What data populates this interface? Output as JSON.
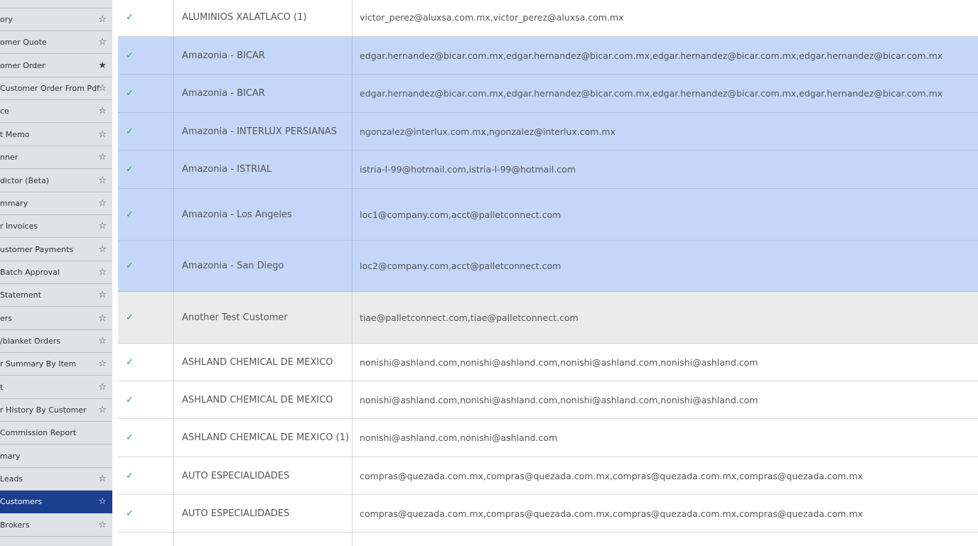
{
  "sidebar": {
    "items": [
      {
        "label": "",
        "starred": false,
        "active": false
      },
      {
        "label": "ory",
        "starred": false,
        "active": false
      },
      {
        "label": "omer Quote",
        "starred": false,
        "active": false
      },
      {
        "label": "omer Order",
        "starred": true,
        "active": false
      },
      {
        "label": "Customer Order From Pdf",
        "starred": false,
        "active": false
      },
      {
        "label": "ce",
        "starred": false,
        "active": false
      },
      {
        "label": "t Memo",
        "starred": false,
        "active": false
      },
      {
        "label": "nner",
        "starred": false,
        "active": false
      },
      {
        "label": "dictor (Beta)",
        "starred": false,
        "active": false
      },
      {
        "label": "mmary",
        "starred": false,
        "active": false
      },
      {
        "label": "r Invoices",
        "starred": false,
        "active": false
      },
      {
        "label": "ustomer Payments",
        "starred": false,
        "active": false
      },
      {
        "label": "Batch Approval",
        "starred": false,
        "active": false
      },
      {
        "label": "Statement",
        "starred": false,
        "active": false
      },
      {
        "label": "ers",
        "starred": false,
        "active": false
      },
      {
        "label": "/blanket Orders",
        "starred": false,
        "active": false
      },
      {
        "label": "r Summary By Item",
        "starred": false,
        "active": false
      },
      {
        "label": "t",
        "starred": false,
        "active": false
      },
      {
        "label": "r History By Customer",
        "starred": false,
        "active": false
      },
      {
        "label": "Commission Report",
        "starred": false,
        "active": false,
        "no_star": true
      },
      {
        "label": "mary",
        "starred": false,
        "active": false,
        "no_star": true
      },
      {
        "label": "Leads",
        "starred": false,
        "active": false
      },
      {
        "label": "Customers",
        "starred": false,
        "active": true
      },
      {
        "label": "Brokers",
        "starred": false,
        "active": false
      }
    ],
    "star_outline": "☆",
    "star_filled": "★"
  },
  "table": {
    "check_glyph": "✓",
    "rows": [
      {
        "name": "ALUMINIOS XALATLACO (1)",
        "emails": "victor_perez@aluxsa.com.mx,victor_perez@aluxsa.com.mx",
        "state": "normal"
      },
      {
        "name": "Amazonia - BICAR",
        "emails": "edgar.hernandez@bicar.com.mx,edgar.hernandez@bicar.com.mx,edgar.hernandez@bicar.com.mx,edgar.hernandez@bicar.com.mx",
        "state": "selected"
      },
      {
        "name": "Amazonia - BICAR",
        "emails": "edgar.hernandez@bicar.com.mx,edgar.hernandez@bicar.com.mx,edgar.hernandez@bicar.com.mx,edgar.hernandez@bicar.com.mx",
        "state": "selected"
      },
      {
        "name": "Amazonia - INTERLUX PERSIANAS",
        "emails": "ngonzalez@interlux.com.mx,ngonzalez@interlux.com.mx",
        "state": "selected"
      },
      {
        "name": "Amazonia - ISTRIAL",
        "emails": "istria-l-99@hotmail.com,istria-l-99@hotmail.com",
        "state": "selected"
      },
      {
        "name": "Amazonia - Los Angeles",
        "emails": "loc1@company.com,acct@palletconnect.com",
        "state": "selected"
      },
      {
        "name": "Amazonia - San Diego",
        "emails": "loc2@company.com,acct@palletconnect.com",
        "state": "selected"
      },
      {
        "name": "Another Test Customer",
        "emails": "tiae@palletconnect.com,tiae@palletconnect.com",
        "state": "hover"
      },
      {
        "name": "ASHLAND CHEMICAL DE MEXICO",
        "emails": "nonishi@ashland.com,nonishi@ashland.com,nonishi@ashland.com,nonishi@ashland.com",
        "state": "normal"
      },
      {
        "name": "ASHLAND CHEMICAL DE MEXICO",
        "emails": "nonishi@ashland.com,nonishi@ashland.com,nonishi@ashland.com,nonishi@ashland.com",
        "state": "normal"
      },
      {
        "name": "ASHLAND CHEMICAL DE MEXICO (1)",
        "emails": "nonishi@ashland.com,nonishi@ashland.com",
        "state": "normal"
      },
      {
        "name": "AUTO ESPECIALIDADES",
        "emails": "compras@quezada.com.mx,compras@quezada.com.mx,compras@quezada.com.mx,compras@quezada.com.mx",
        "state": "normal"
      },
      {
        "name": "AUTO ESPECIALIDADES",
        "emails": "compras@quezada.com.mx,compras@quezada.com.mx,compras@quezada.com.mx,compras@quezada.com.mx",
        "state": "normal"
      },
      {
        "name": "",
        "emails": "",
        "state": "normal",
        "no_check": true
      }
    ]
  },
  "colors": {
    "sidebar_bg": "#dfe2e7",
    "sidebar_active": "#1c3f8c",
    "row_selected": "#c4d7f8",
    "row_hover": "#ebebeb",
    "check_green": "#2aa64b"
  }
}
